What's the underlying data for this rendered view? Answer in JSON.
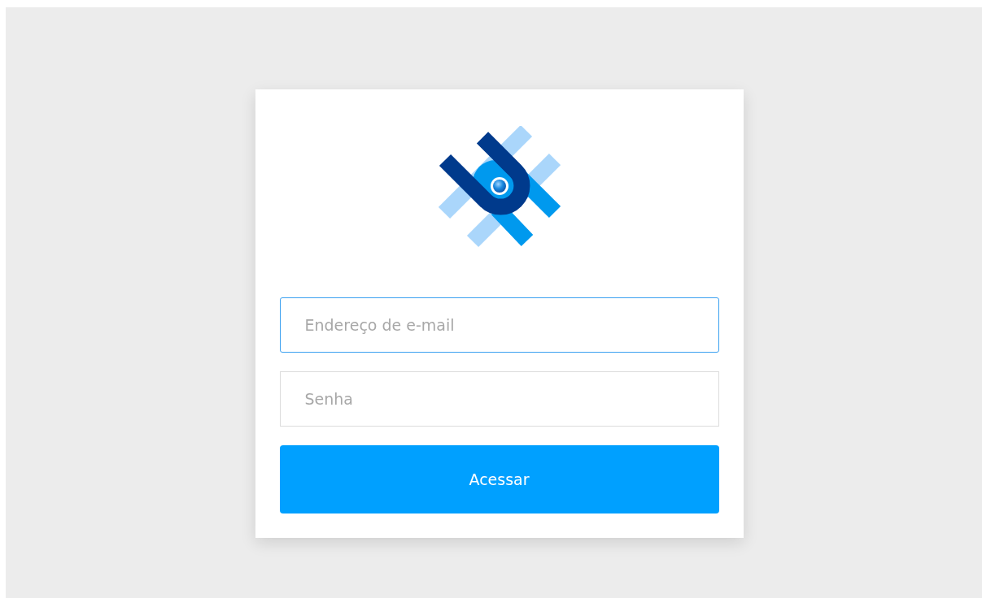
{
  "login_form": {
    "email_field": {
      "placeholder": "Endereço de e-mail",
      "focused": true
    },
    "password_field": {
      "placeholder": "Senha",
      "focused": false
    },
    "submit_button": {
      "label": "Acessar"
    }
  }
}
